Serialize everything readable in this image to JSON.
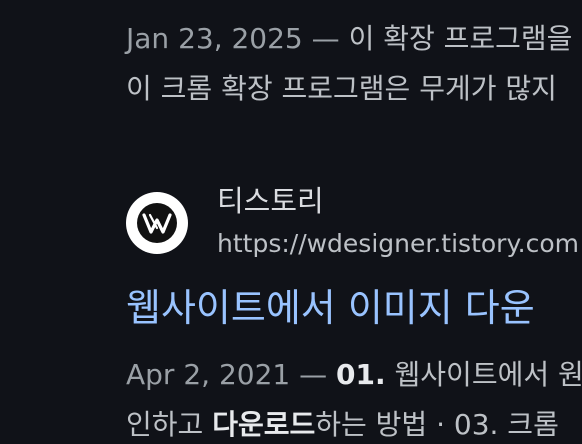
{
  "result_prev": {
    "date": "Jan 23, 2025",
    "separator": "—",
    "snippet_line1": "이 확장 프로그램을",
    "snippet_line2": "이 크롬 확장 프로그램은 무게가 많지"
  },
  "result_main": {
    "site_name": "티스토리",
    "url": "https://wdesigner.tistory.com",
    "title": "웹사이트에서 이미지 다운",
    "date": "Apr 2, 2021",
    "separator": "—",
    "snippet_line1_bold": "01.",
    "snippet_line1_rest": " 웹사이트에서 원",
    "snippet_line2_pre": "인하고 ",
    "snippet_line2_bold": "다운로드",
    "snippet_line2_post": "하는 방법 · 03. 크롬",
    "favicon_icon": "w-logo-icon"
  },
  "colors": {
    "background": "#101218",
    "link": "#99c3ff",
    "text": "#bdc1c6",
    "muted": "#9aa0a6"
  }
}
